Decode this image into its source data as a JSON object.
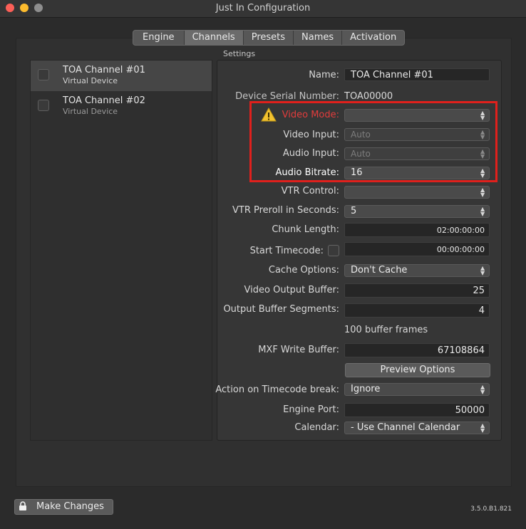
{
  "window": {
    "title": "Just In Configuration"
  },
  "tabs": [
    {
      "label": "Engine"
    },
    {
      "label": "Channels",
      "active": true
    },
    {
      "label": "Presets"
    },
    {
      "label": "Names"
    },
    {
      "label": "Activation"
    }
  ],
  "channels": [
    {
      "name": "TOA Channel #01",
      "subtitle": "Virtual Device",
      "selected": true,
      "checked": false
    },
    {
      "name": "TOA Channel #02",
      "subtitle": "Virtual Device",
      "selected": false,
      "checked": false
    }
  ],
  "settings": {
    "caption": "Settings",
    "name_label": "Name:",
    "name_value": "TOA Channel #01",
    "serial_label": "Device Serial Number:",
    "serial_value": "TOA00000",
    "video_mode_label": "Video Mode:",
    "video_mode_value": "",
    "video_input_label": "Video Input:",
    "video_input_value": "Auto",
    "audio_input_label": "Audio Input:",
    "audio_input_value": "Auto",
    "audio_bitrate_label": "Audio Bitrate:",
    "audio_bitrate_value": "16",
    "vtr_control_label": "VTR Control:",
    "vtr_control_value": "",
    "vtr_preroll_label": "VTR Preroll in Seconds:",
    "vtr_preroll_value": "5",
    "chunk_length_label": "Chunk Length:",
    "chunk_length_value": "02:00:00:00",
    "start_timecode_label": "Start Timecode:",
    "start_timecode_checked": false,
    "start_timecode_value": "00:00:00:00",
    "cache_options_label": "Cache Options:",
    "cache_options_value": "Don't Cache",
    "video_output_buffer_label": "Video Output Buffer:",
    "video_output_buffer_value": "25",
    "output_buffer_segments_label": "Output Buffer Segments:",
    "output_buffer_segments_value": "4",
    "buffer_frames_note": "100 buffer frames",
    "mxf_write_buffer_label": "MXF Write Buffer:",
    "mxf_write_buffer_value": "67108864",
    "preview_options_button": "Preview Options",
    "timecode_break_label": "Action on Timecode break:",
    "timecode_break_value": "Ignore",
    "engine_port_label": "Engine Port:",
    "engine_port_value": "50000",
    "calendar_label": "Calendar:",
    "calendar_value": "- Use Channel Calendar"
  },
  "footer": {
    "make_changes_label": "Make Changes",
    "version": "3.5.0.B1.821"
  },
  "colors": {
    "warning_label": "#e23c3c",
    "highlight_box": "#e0201c",
    "warning_icon": "#f2c230"
  },
  "icons": {
    "warning": "warning-icon",
    "lock": "lock-icon",
    "popup_arrows": "updown-arrows-icon"
  }
}
